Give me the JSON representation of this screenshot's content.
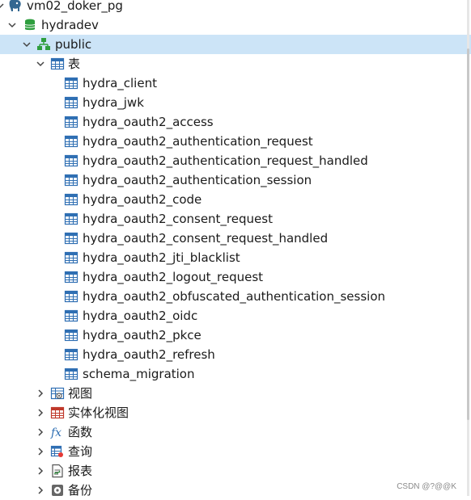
{
  "tree": {
    "connection": {
      "label": "vm02_doker_pg",
      "icon": "postgres-elephant-icon",
      "expanded": true
    },
    "database": {
      "label": "hydradev",
      "icon": "database-icon",
      "expanded": true
    },
    "schema": {
      "label": "public",
      "icon": "schema-icon",
      "expanded": true,
      "selected": true
    },
    "tables_folder": {
      "label": "表",
      "icon": "table-folder-icon",
      "expanded": true
    },
    "tables": [
      "hydra_client",
      "hydra_jwk",
      "hydra_oauth2_access",
      "hydra_oauth2_authentication_request",
      "hydra_oauth2_authentication_request_handled",
      "hydra_oauth2_authentication_session",
      "hydra_oauth2_code",
      "hydra_oauth2_consent_request",
      "hydra_oauth2_consent_request_handled",
      "hydra_oauth2_jti_blacklist",
      "hydra_oauth2_logout_request",
      "hydra_oauth2_obfuscated_authentication_session",
      "hydra_oauth2_oidc",
      "hydra_oauth2_pkce",
      "hydra_oauth2_refresh",
      "schema_migration"
    ],
    "folders": [
      {
        "label": "视图",
        "icon": "view-icon"
      },
      {
        "label": "实体化视图",
        "icon": "materialized-view-icon"
      },
      {
        "label": "函数",
        "icon": "function-icon"
      },
      {
        "label": "查询",
        "icon": "query-icon"
      },
      {
        "label": "报表",
        "icon": "report-icon"
      },
      {
        "label": "备份",
        "icon": "backup-icon"
      }
    ]
  },
  "watermark": "CSDN @?@@K",
  "colors": {
    "selection": "#cce4f7",
    "table_icon": "#2f6fb3",
    "db_icon": "#2e9e3e"
  }
}
